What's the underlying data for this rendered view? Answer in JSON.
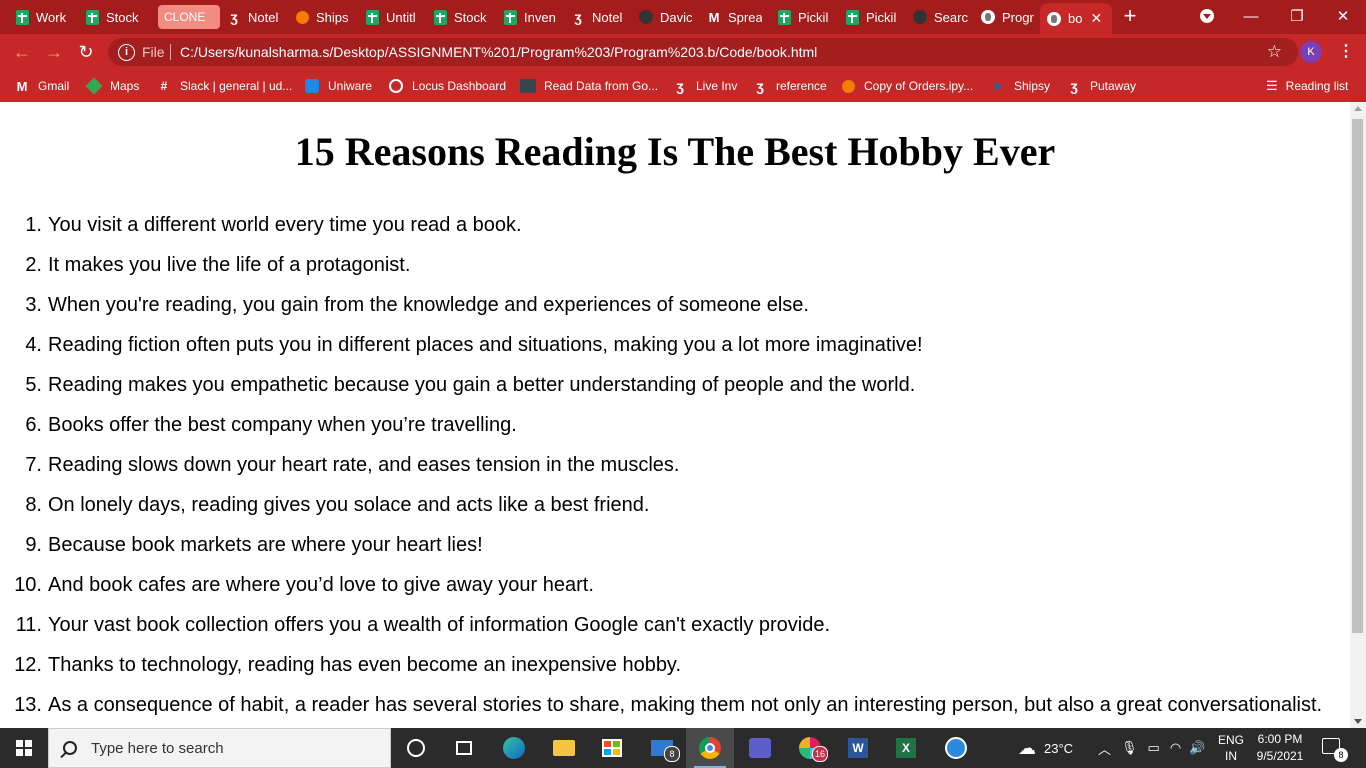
{
  "browser": {
    "tabs": [
      {
        "label": "Work",
        "icon": "sheets-icon"
      },
      {
        "label": "Stock",
        "icon": "sheets-icon"
      },
      {
        "label": "CLONE",
        "icon": ""
      },
      {
        "label": "Notel",
        "icon": "zap-icon"
      },
      {
        "label": "Ships",
        "icon": "jupyter-icon"
      },
      {
        "label": "Untitl",
        "icon": "sheets-icon"
      },
      {
        "label": "Stock",
        "icon": "sheets-icon"
      },
      {
        "label": "Inven",
        "icon": "sheets-icon"
      },
      {
        "label": "Notel",
        "icon": "zap-icon"
      },
      {
        "label": "Davic",
        "icon": "github-icon"
      },
      {
        "label": "Sprea",
        "icon": "gmail-icon"
      },
      {
        "label": "Pickil",
        "icon": "sheets-icon"
      },
      {
        "label": "Pickil",
        "icon": "sheets-icon"
      },
      {
        "label": "Searc",
        "icon": "github-icon"
      },
      {
        "label": "Progr",
        "icon": "globe-icon"
      },
      {
        "label": "bo",
        "icon": "globe-icon"
      }
    ],
    "address": {
      "scheme_label": "File",
      "url": "C:/Users/kunalsharma.s/Desktop/ASSIGNMENT%201/Program%203/Program%203.b/Code/book.html"
    },
    "profile_initial": "K",
    "bookmarks": [
      {
        "label": "Gmail"
      },
      {
        "label": "Maps"
      },
      {
        "label": "Slack | general | ud..."
      },
      {
        "label": "Uniware"
      },
      {
        "label": "Locus Dashboard"
      },
      {
        "label": "Read Data from Go..."
      },
      {
        "label": "Live Inv"
      },
      {
        "label": "reference"
      },
      {
        "label": "Copy of Orders.ipy..."
      },
      {
        "label": "Shipsy"
      },
      {
        "label": "Putaway"
      }
    ],
    "reading_list_label": "Reading list"
  },
  "page": {
    "title": "15 Reasons Reading Is The Best Hobby Ever",
    "reasons": [
      {
        "num": "1.",
        "text": "You visit a different world every time you read a book."
      },
      {
        "num": "2.",
        "text": "It makes you live the life of a protagonist."
      },
      {
        "num": "3.",
        "text": "When you're reading, you gain from the knowledge and experiences of someone else."
      },
      {
        "num": "4.",
        "text": "Reading fiction often puts you in different places and situations, making you a lot more imaginative!"
      },
      {
        "num": "5.",
        "text": "Reading makes you empathetic because you gain a better understanding of people and the world."
      },
      {
        "num": "6.",
        "text": "Books offer the best company when you’re travelling."
      },
      {
        "num": "7.",
        "text": "Reading slows down your heart rate, and eases tension in the muscles."
      },
      {
        "num": "8.",
        "text": "On lonely days, reading gives you solace and acts like a best friend."
      },
      {
        "num": "9.",
        "text": "Because book markets are where your heart lies!"
      },
      {
        "num": "10.",
        "text": "And book cafes are where you’d love to give away your heart."
      },
      {
        "num": "11.",
        "text": "Your vast book collection offers you a wealth of information Google can't exactly provide."
      },
      {
        "num": "12.",
        "text": "Thanks to technology, reading has even become an inexpensive hobby."
      },
      {
        "num": "13.",
        "text": "As a consequence of habit, a reader has several stories to share, making them not only an interesting person, but also a great conversationalist."
      }
    ]
  },
  "taskbar": {
    "search_placeholder": "Type here to search",
    "mail_badge": "8",
    "slack_badge": "16",
    "weather": "23°C",
    "language": "ENG",
    "region": "IN",
    "time": "6:00 PM",
    "date": "9/5/2021",
    "notification_count": "8"
  },
  "colors": {
    "browser_frame": "#a51c1c",
    "toolbar": "#c62828",
    "taskbar": "#2b2b2b"
  }
}
